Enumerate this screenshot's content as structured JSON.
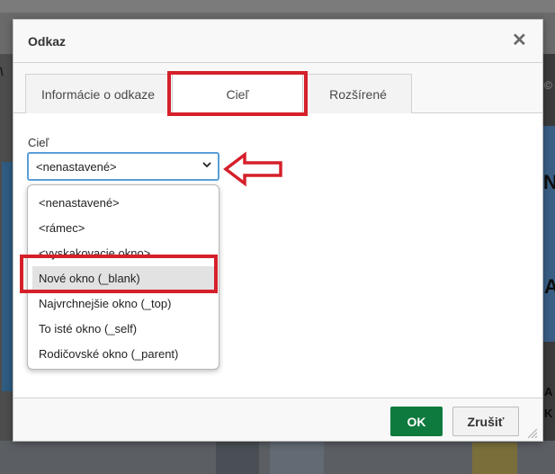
{
  "dialog": {
    "title": "Odkaz",
    "close_glyph": "✕"
  },
  "tabs": [
    {
      "label": "Informácie o odkaze",
      "active": false
    },
    {
      "label": "Cieľ",
      "active": true
    },
    {
      "label": "Rozšírené",
      "active": false
    }
  ],
  "target": {
    "label": "Cieľ",
    "selected_value": "<nenastavené>",
    "chevron": "⌄",
    "options": [
      {
        "label": "<nenastavené>",
        "highlighted": false
      },
      {
        "label": "<rámec>",
        "highlighted": false
      },
      {
        "label": "<vyskakovacie okno>",
        "highlighted": false
      },
      {
        "label": "Nové okno (_blank)",
        "highlighted": true
      },
      {
        "label": "Najvrchnejšie okno (_top)",
        "highlighted": false
      },
      {
        "label": "To isté okno (_self)",
        "highlighted": false
      },
      {
        "label": "Rodičovské okno (_parent)",
        "highlighted": false
      }
    ]
  },
  "footer": {
    "ok_label": "OK",
    "cancel_label": "Zrušiť"
  },
  "background_fragments": {
    "left_glyph": "\\",
    "right_t1": "N",
    "right_t2": "A",
    "right_t3": "A",
    "right_t4": "K",
    "right_t5": "©"
  },
  "colors": {
    "ok_button": "#0f7a3e",
    "select_focus_border": "#5a9ed8",
    "annotation_red": "#d5202a"
  }
}
